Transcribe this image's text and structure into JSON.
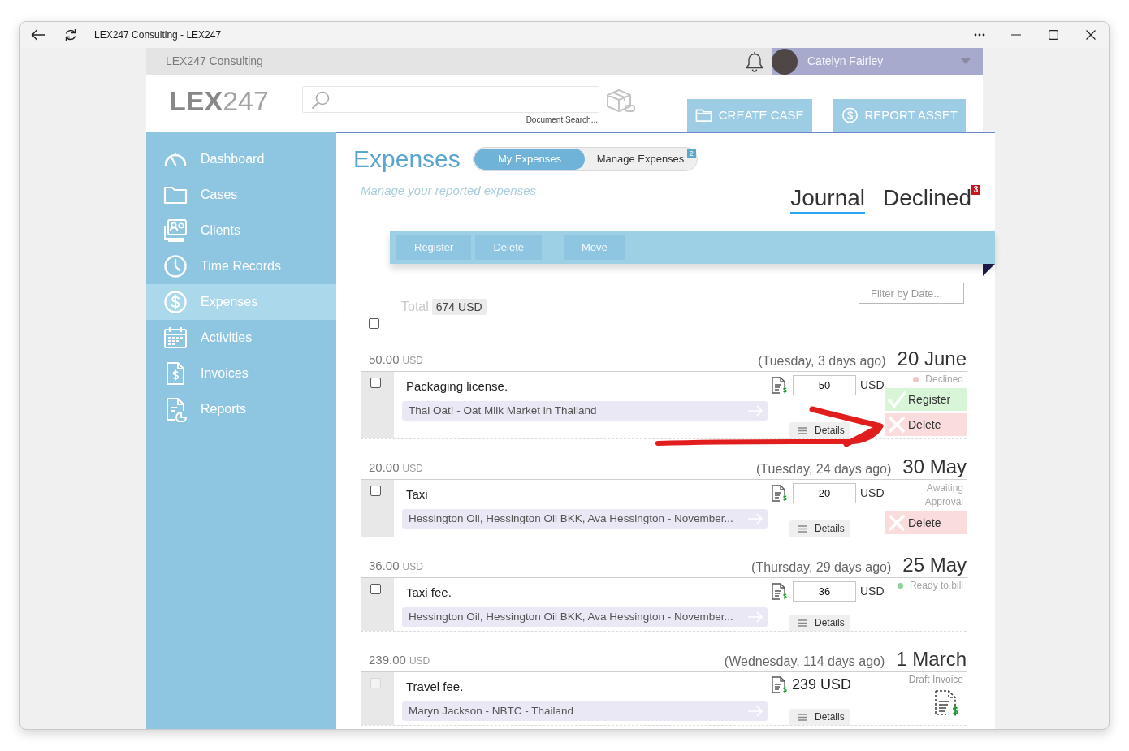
{
  "window": {
    "title": "LEX247 Consulting - LEX247"
  },
  "top_bar": {
    "company": "LEX247 Consulting",
    "user_name": "Catelyn Fairley"
  },
  "header": {
    "logo": "**LEX**247",
    "search": {
      "caption": "Document Search..."
    },
    "buttons": [
      {
        "label": "CREATE CASE"
      },
      {
        "label": "REPORT ASSET"
      }
    ]
  },
  "sidebar": {
    "items": [
      {
        "label": "Dashboard",
        "selected": false
      },
      {
        "label": "Cases",
        "selected": false
      },
      {
        "label": "Clients",
        "selected": false
      },
      {
        "label": "Time Records",
        "selected": false
      },
      {
        "label": "Expenses",
        "selected": true
      },
      {
        "label": "Activities",
        "selected": false
      },
      {
        "label": "Invoices",
        "selected": false
      },
      {
        "label": "Reports",
        "selected": false
      }
    ]
  },
  "page": {
    "title": "Expenses",
    "switch": [
      {
        "label": "My Expenses",
        "selected": true
      },
      {
        "label": "Manage Expenses",
        "selected": false,
        "badge": "2"
      }
    ],
    "subtitle": "Manage your reported expenses",
    "tabs": [
      {
        "label": "Journal",
        "selected": true
      },
      {
        "label": "Declined",
        "selected": false,
        "badge": "3"
      }
    ]
  },
  "toolbar": {
    "buttons": [
      {
        "label": "Register",
        "disabled": true
      },
      {
        "label": "Delete",
        "disabled": true
      },
      {
        "label": "Move",
        "disabled": true
      }
    ]
  },
  "date_filter": {
    "placeholder": "Filter by Date..."
  },
  "total": {
    "label": "Total",
    "value": "674 USD"
  },
  "select_all": {
    "checked": false
  },
  "expenses": [
    {
      "amount": "50.00",
      "currency": "USD",
      "weekday": "(Tuesday, 3 days ago)",
      "date": "20 June",
      "checked": false,
      "disabled": false,
      "description": "Packaging license.",
      "matter": "Thai Oat! - Oat Milk Market in Thailand",
      "kind": "editable",
      "value": "50",
      "unit": "USD",
      "details": "Details",
      "status": {
        "kind": "dot",
        "label": "Declined",
        "color": "#f4c4c4"
      },
      "actions": [
        {
          "kind": "register",
          "label": "Register"
        },
        {
          "kind": "delete",
          "label": "Delete"
        }
      ]
    },
    {
      "amount": "20.00",
      "currency": "USD",
      "weekday": "(Tuesday, 24 days ago)",
      "date": "30 May",
      "checked": false,
      "disabled": false,
      "description": "Taxi",
      "matter": "Hessington Oil, Hessington Oil BKK, Ava Hessington - November...",
      "kind": "editable",
      "value": "20",
      "unit": "USD",
      "details": "Details",
      "status": {
        "kind": "plain",
        "label": "Awaiting Approval"
      },
      "actions": [
        {
          "kind": "delete",
          "label": "Delete"
        }
      ]
    },
    {
      "amount": "36.00",
      "currency": "USD",
      "weekday": "(Thursday, 29 days ago)",
      "date": "25 May",
      "checked": false,
      "disabled": false,
      "description": "Taxi fee.",
      "matter": "Hessington Oil, Hessington Oil BKK, Ava Hessington - November...",
      "kind": "editable",
      "value": "36",
      "unit": "USD",
      "details": "Details",
      "status": {
        "kind": "dot",
        "label": "Ready to bill",
        "color": "#8fd19b"
      }
    },
    {
      "amount": "239.00",
      "currency": "USD",
      "weekday": "(Wednesday, 114 days ago)",
      "date": "1 March",
      "checked": false,
      "disabled": true,
      "description": "Travel fee.",
      "matter": "Maryn Jackson - NBTC - Thailand",
      "kind": "fixed",
      "total": "239 USD",
      "details": "Details",
      "status": {
        "kind": "invoice",
        "label": "Draft Invoice"
      }
    }
  ]
}
